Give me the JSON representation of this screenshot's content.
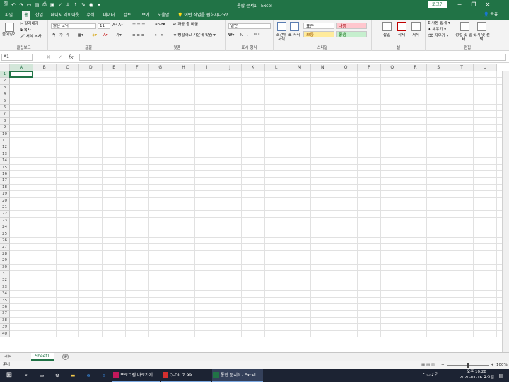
{
  "window": {
    "title": "통합 문서1  -  Excel",
    "signin_label": "로그인",
    "minimize_glyph": "─",
    "restore_glyph": "❐",
    "close_glyph": "✕"
  },
  "qat": {
    "icons": [
      "save",
      "undo",
      "redo",
      "new",
      "open",
      "print",
      "preview",
      "spell",
      "sort-asc",
      "sort-desc",
      "draw",
      "camera",
      "more"
    ],
    "glyphs": [
      "🖫",
      "↶",
      "↷",
      "▭",
      "▤",
      "⎙",
      "▣",
      "✓",
      "↓",
      "↑",
      "✎",
      "◉",
      "▾"
    ]
  },
  "tabs": [
    {
      "label": "파일",
      "active": false
    },
    {
      "label": "홈",
      "active": true
    },
    {
      "label": "삽입",
      "active": false
    },
    {
      "label": "페이지 레이아웃",
      "active": false
    },
    {
      "label": "수식",
      "active": false
    },
    {
      "label": "데이터",
      "active": false
    },
    {
      "label": "검토",
      "active": false
    },
    {
      "label": "보기",
      "active": false
    },
    {
      "label": "도움말",
      "active": false
    }
  ],
  "tell_me": "어떤 작업을 원하시나요?",
  "share_label": "공유",
  "ribbon": {
    "clipboard": {
      "label": "클립보드",
      "paste": "붙여넣기",
      "cut": "잘라내기",
      "copy": "복사",
      "format_painter": "서식 복사"
    },
    "font": {
      "label": "글꼴",
      "font_name": "맑은 고딕",
      "font_size": "11",
      "bold": "가",
      "italic": "가",
      "underline": "가"
    },
    "alignment": {
      "label": "맞춤",
      "wrap": "자동 줄 바꿈",
      "merge": "병합하고 가운데 맞춤"
    },
    "number": {
      "label": "표시 형식",
      "format": "일반",
      "percent": "%",
      "comma": ","
    },
    "styles": {
      "label": "스타일",
      "conditional": "조건부 서식",
      "as_table": "표 서식",
      "cells": [
        {
          "text": "표준",
          "bg": "#ffffff",
          "color": "#222222"
        },
        {
          "text": "나쁨",
          "bg": "#ffc7ce",
          "color": "#9c0006"
        },
        {
          "text": "보통",
          "bg": "#ffeb9c",
          "color": "#9c5700"
        },
        {
          "text": "좋음",
          "bg": "#c6efce",
          "color": "#006100"
        }
      ]
    },
    "cells": {
      "label": "셀",
      "insert": "삽입",
      "delete": "삭제",
      "format": "서식"
    },
    "editing": {
      "label": "편집",
      "autosum": "자동 합계",
      "fill": "채우기",
      "clear": "지우기",
      "sort_filter": "정렬 및 필터",
      "find_select": "찾기 및 선택"
    }
  },
  "formula_bar": {
    "name_box": "A1",
    "cancel": "✕",
    "enter": "✓",
    "fx": "fx",
    "value": ""
  },
  "columns": [
    "A",
    "B",
    "C",
    "D",
    "E",
    "F",
    "G",
    "H",
    "I",
    "J",
    "K",
    "L",
    "M",
    "N",
    "O",
    "P",
    "Q",
    "R",
    "S",
    "T",
    "U"
  ],
  "rows": [
    "1",
    "2",
    "3",
    "4",
    "5",
    "6",
    "7",
    "8",
    "9",
    "10",
    "11",
    "12",
    "13",
    "14",
    "15",
    "16",
    "17",
    "18",
    "19",
    "20",
    "21",
    "22",
    "23",
    "24",
    "25",
    "26",
    "27",
    "28",
    "29",
    "30",
    "31",
    "32",
    "33",
    "34",
    "35",
    "36",
    "37",
    "38",
    "39",
    "40"
  ],
  "active_cell": "A1",
  "sheets": [
    {
      "name": "Sheet1",
      "active": true
    }
  ],
  "add_sheet": "⊕",
  "status": {
    "ready": "준비",
    "zoom": "100%",
    "zoom_minus": "−",
    "zoom_plus": "+"
  },
  "taskbar": {
    "apps": [
      {
        "label": "프로그램 바로가기",
        "color": "#c2185b"
      },
      {
        "label": "Q-Dir 7.99",
        "color": "#d32f2f"
      },
      {
        "label": "통합 문서1 - Excel",
        "color": "#217346"
      }
    ],
    "time": "오후 10:28",
    "date": "2020-01-16 목요일"
  },
  "accent": "#217346"
}
